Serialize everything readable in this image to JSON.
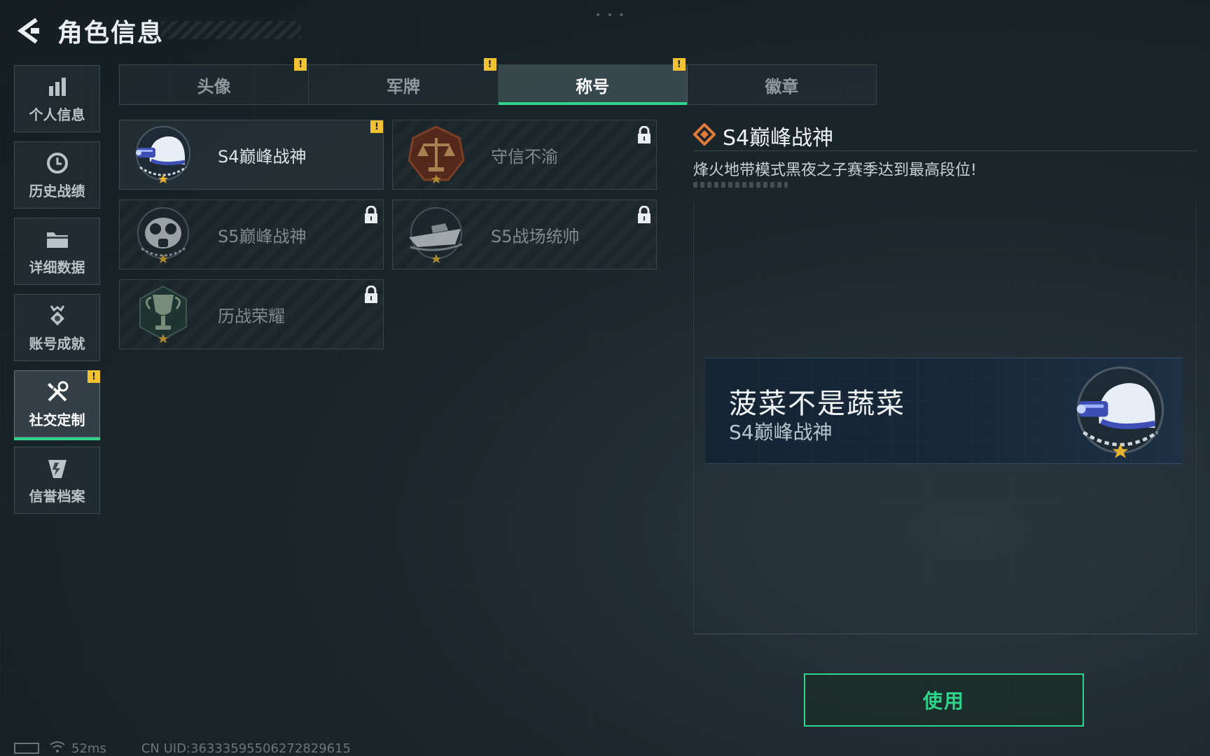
{
  "header": {
    "title": "角色信息"
  },
  "sidebar": {
    "items": [
      {
        "label": "个人信息",
        "icon": "bar-chart-icon"
      },
      {
        "label": "历史战绩",
        "icon": "clock-icon"
      },
      {
        "label": "详细数据",
        "icon": "folder-icon"
      },
      {
        "label": "账号成就",
        "icon": "medal-icon"
      },
      {
        "label": "社交定制",
        "icon": "tools-icon",
        "active": true,
        "alert": "!"
      },
      {
        "label": "信誉档案",
        "icon": "shield-icon"
      }
    ]
  },
  "tabs": [
    {
      "label": "头像",
      "alert": "!"
    },
    {
      "label": "军牌",
      "alert": "!"
    },
    {
      "label": "称号",
      "alert": "!",
      "active": true
    },
    {
      "label": "徽章"
    }
  ],
  "titles": [
    {
      "name": "S4巅峰战神",
      "emblem": "helmet-nightvision-emblem",
      "locked": false,
      "alert": "!"
    },
    {
      "name": "守信不渝",
      "emblem": "justice-scales-emblem",
      "locked": true
    },
    {
      "name": "S5巅峰战神",
      "emblem": "gasmask-emblem",
      "locked": true
    },
    {
      "name": "S5战场统帅",
      "emblem": "boat-emblem",
      "locked": true
    },
    {
      "name": "历战荣耀",
      "emblem": "trophy-emblem",
      "locked": true
    }
  ],
  "detail": {
    "title": "S4巅峰战神",
    "description": "烽火地带模式黑夜之子赛季达到最高段位!"
  },
  "preview": {
    "player_name": "菠菜不是蔬菜",
    "player_title": "S4巅峰战神"
  },
  "use_button": {
    "label": "使用"
  },
  "status": {
    "ping": "52ms",
    "uid": "CN UID:3633359550627282961​5"
  },
  "colors": {
    "accent": "#2fd38a",
    "alert": "#f2c230",
    "emblem_blue": "#3d4fb5",
    "detail_icon": "#e07a3a"
  }
}
